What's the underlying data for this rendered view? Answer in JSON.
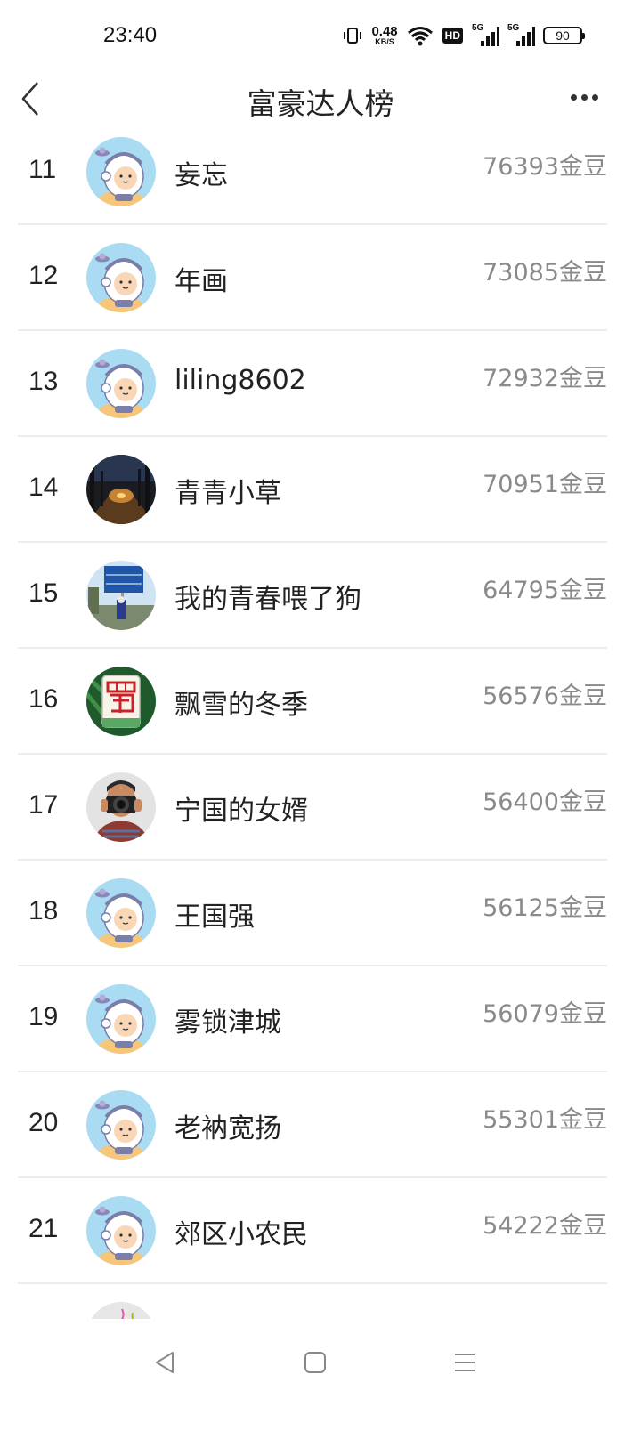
{
  "status_bar": {
    "time": "23:40",
    "net_speed_value": "0.48",
    "net_speed_unit": "KB/S",
    "hd_label": "HD",
    "signal1_label": "5G",
    "signal2_label": "5G",
    "battery_level": "90",
    "icons": [
      "vibrate-icon",
      "wifi-icon",
      "hd-icon",
      "signal-icon",
      "signal-icon",
      "battery-icon"
    ]
  },
  "header": {
    "title": "富豪达人榜",
    "back_icon": "chevron-left-icon",
    "more_icon": "more-icon"
  },
  "ranking": [
    {
      "rank": "11",
      "name": "妄忘",
      "beans": "76393金豆",
      "avatar": "astronaut"
    },
    {
      "rank": "12",
      "name": "年画",
      "beans": "73085金豆",
      "avatar": "astronaut"
    },
    {
      "rank": "13",
      "name": "liling8602",
      "beans": "72932金豆",
      "avatar": "astronaut"
    },
    {
      "rank": "14",
      "name": "青青小草",
      "beans": "70951金豆",
      "avatar": "forest-road"
    },
    {
      "rank": "15",
      "name": "我的青春喂了狗",
      "beans": "64795金豆",
      "avatar": "road-sign"
    },
    {
      "rank": "16",
      "name": "飘雪的冬季",
      "beans": "56576金豆",
      "avatar": "mahjong-tile"
    },
    {
      "rank": "17",
      "name": "宁国的女婿",
      "beans": "56400金豆",
      "avatar": "photographer"
    },
    {
      "rank": "18",
      "name": "王国强",
      "beans": "56125金豆",
      "avatar": "astronaut"
    },
    {
      "rank": "19",
      "name": "雾锁津城",
      "beans": "56079金豆",
      "avatar": "astronaut"
    },
    {
      "rank": "20",
      "name": "老衲宽扬",
      "beans": "55301金豆",
      "avatar": "astronaut"
    },
    {
      "rank": "21",
      "name": "郊区小农民",
      "beans": "54222金豆",
      "avatar": "astronaut"
    },
    {
      "rank": "",
      "name": "",
      "beans": "",
      "avatar": "partial"
    }
  ],
  "nav_bar": {
    "icons": [
      "back-triangle-icon",
      "home-square-icon",
      "menu-lines-icon"
    ]
  }
}
